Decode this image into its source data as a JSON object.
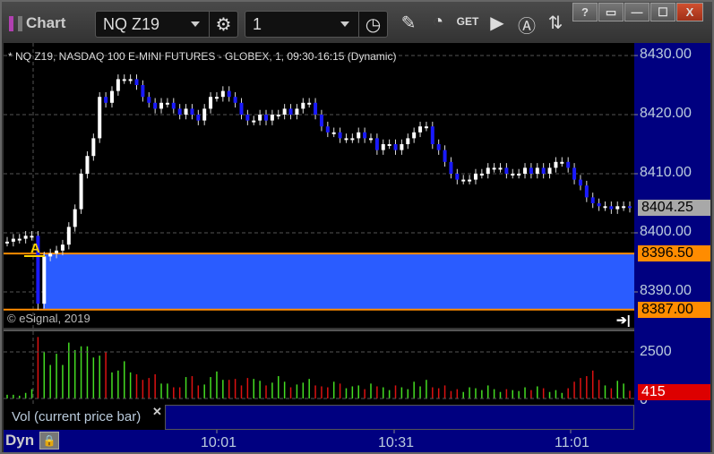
{
  "window": {
    "title": "Chart",
    "help": "?",
    "buttons": [
      "?",
      "▭",
      "—",
      "☐",
      "X"
    ]
  },
  "toolbar": {
    "symbol": "NQ Z19",
    "interval": "1",
    "tools": [
      "pencil-icon",
      "study-icon",
      "get-icon",
      "play-icon",
      "alert-icon",
      "link-icon"
    ]
  },
  "chart": {
    "header": "* NQ Z19, NASDAQ 100 E-MINI FUTURES - GLOBEX, 1, 09:30-16:15 (Dynamic)",
    "copyright": "© eSignal, 2019",
    "marker": "A"
  },
  "colors": {
    "up": "#ffffff",
    "down": "#1a1aff",
    "zone": "#2a5cff",
    "zone_line": "#ff8c00",
    "vol_up": "#44dd22",
    "vol_down": "#dd1111",
    "axis_bg": "#000080"
  },
  "chart_data": {
    "type": "candlestick",
    "yticks": [
      "8430.00",
      "8420.00",
      "8410.00",
      "8400.00",
      "8390.00"
    ],
    "ylim": [
      8386,
      8433
    ],
    "xticks": [
      "10:01",
      "10:31",
      "11:01"
    ],
    "last_price": "8404.25",
    "zone": {
      "high": "8396.50",
      "low": "8387.00"
    },
    "closes": [
      8398.5,
      8399,
      8399,
      8399.5,
      8399.5,
      8388,
      8396,
      8396.5,
      8397,
      8398,
      8401,
      8404,
      8410,
      8413,
      8416,
      8423,
      8422,
      8424,
      8426,
      8426,
      8426,
      8425,
      8423,
      8422,
      8421,
      8422,
      8422,
      8421,
      8420,
      8421,
      8420,
      8419,
      8421,
      8423,
      8423,
      8424,
      8423,
      8422,
      8420,
      8419,
      8419,
      8420,
      8419,
      8420,
      8420,
      8421,
      8420,
      8421,
      8422,
      8422,
      8420,
      8418,
      8417,
      8417,
      8416,
      8416,
      8416,
      8417,
      8416,
      8416,
      8414,
      8415,
      8415,
      8414,
      8415,
      8416,
      8417,
      8418,
      8418,
      8415,
      8414,
      8412,
      8410,
      8409,
      8409,
      8409,
      8410,
      8410,
      8411,
      8411,
      8411,
      8410,
      8410,
      8410,
      8411,
      8410,
      8411,
      8410,
      8411,
      8412,
      8412,
      8411,
      8409,
      8408,
      8406,
      8405,
      8404.5,
      8404.5,
      8404,
      8404.5,
      8404.5,
      8404.25
    ],
    "volume": {
      "ytick": "2500",
      "zero": "0",
      "last": "415",
      "values": [
        200,
        200,
        150,
        300,
        500,
        3300,
        2500,
        1800,
        2400,
        1800,
        3000,
        2600,
        2800,
        2800,
        2200,
        2300,
        2500,
        1400,
        1500,
        2000,
        1400,
        1300,
        1000,
        1100,
        1300,
        800,
        800,
        600,
        600,
        1150,
        1200,
        700,
        750,
        1150,
        1450,
        1000,
        1000,
        1050,
        700,
        1100,
        1050,
        950,
        700,
        850,
        1200,
        900,
        600,
        750,
        850,
        1050,
        700,
        650,
        600,
        900,
        800,
        550,
        650,
        700,
        500,
        800,
        650,
        600,
        450,
        700,
        600,
        500,
        900,
        650,
        1000,
        600,
        550,
        700,
        400,
        500,
        350,
        600,
        550,
        450,
        700,
        500,
        350,
        500,
        450,
        400,
        600,
        450,
        650,
        550,
        350,
        450,
        300,
        550,
        900,
        1100,
        1200,
        1500,
        1000,
        700,
        550,
        950,
        800,
        415
      ]
    }
  }
}
